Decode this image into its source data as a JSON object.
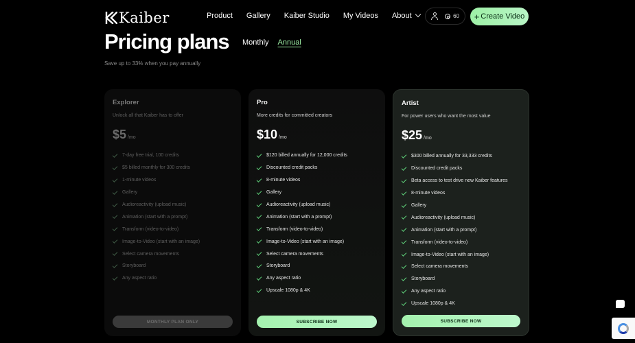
{
  "brand": {
    "name": "Kaiber"
  },
  "nav": {
    "links": [
      "Product",
      "Gallery",
      "Kaiber Studio",
      "My Videos"
    ],
    "about": "About"
  },
  "account": {
    "credits": "60"
  },
  "create_button": {
    "plus": "+",
    "label": "Create Video"
  },
  "header": {
    "title": "Pricing plans",
    "toggle_monthly": "Monthly",
    "toggle_annual": "Annual",
    "subtitle": "Save up to 33% when you pay annually"
  },
  "plans": [
    {
      "name": "Explorer",
      "desc": "Unlock all that Kaiber has to offer",
      "price": "$5",
      "per": "/mo",
      "features": [
        "7-day free trial, 100 credits",
        "$5 billed monthly for 300 credits",
        "1-minute videos",
        "Gallery",
        "Audioreactivity (upload music)",
        "Animation (start with a prompt)",
        "Transform (video-to-video)",
        "Image-to-Video (start with an image)",
        "Select camera movements",
        "Storyboard",
        "Any aspect ratio"
      ],
      "cta": "MONTHLY PLAN ONLY"
    },
    {
      "name": "Pro",
      "desc": "More credits for committed creators",
      "price": "$10",
      "per": "/mo",
      "features": [
        "$120 billed annually for 12,000 credits",
        "Discounted credit packs",
        "8-minute videos",
        "Gallery",
        "Audioreactivity (upload music)",
        "Animation (start with a prompt)",
        "Transform (video-to-video)",
        "Image-to-Video (start with an image)",
        "Select camera movements",
        "Storyboard",
        "Any aspect ratio",
        "Upscale 1080p & 4K"
      ],
      "cta": "SUBSCRIBE NOW"
    },
    {
      "name": "Artist",
      "desc": "For power users who want the most value",
      "price": "$25",
      "per": "/mo",
      "features": [
        "$300 billed annually for 33,333 credits",
        "Discounted credit packs",
        "Beta access to test drive new Kaiber features",
        "8-minute videos",
        "Gallery",
        "Audioreactivity (upload music)",
        "Animation (start with a prompt)",
        "Transform (video-to-video)",
        "Image-to-Video (start with an image)",
        "Select camera movements",
        "Storyboard",
        "Any aspect ratio",
        "Upscale 1080p & 4K"
      ],
      "cta": "SUBSCRIBE NOW"
    }
  ],
  "colors": {
    "accent": "#9ef0a6",
    "check": "#5fd17a",
    "background": "#000000"
  }
}
